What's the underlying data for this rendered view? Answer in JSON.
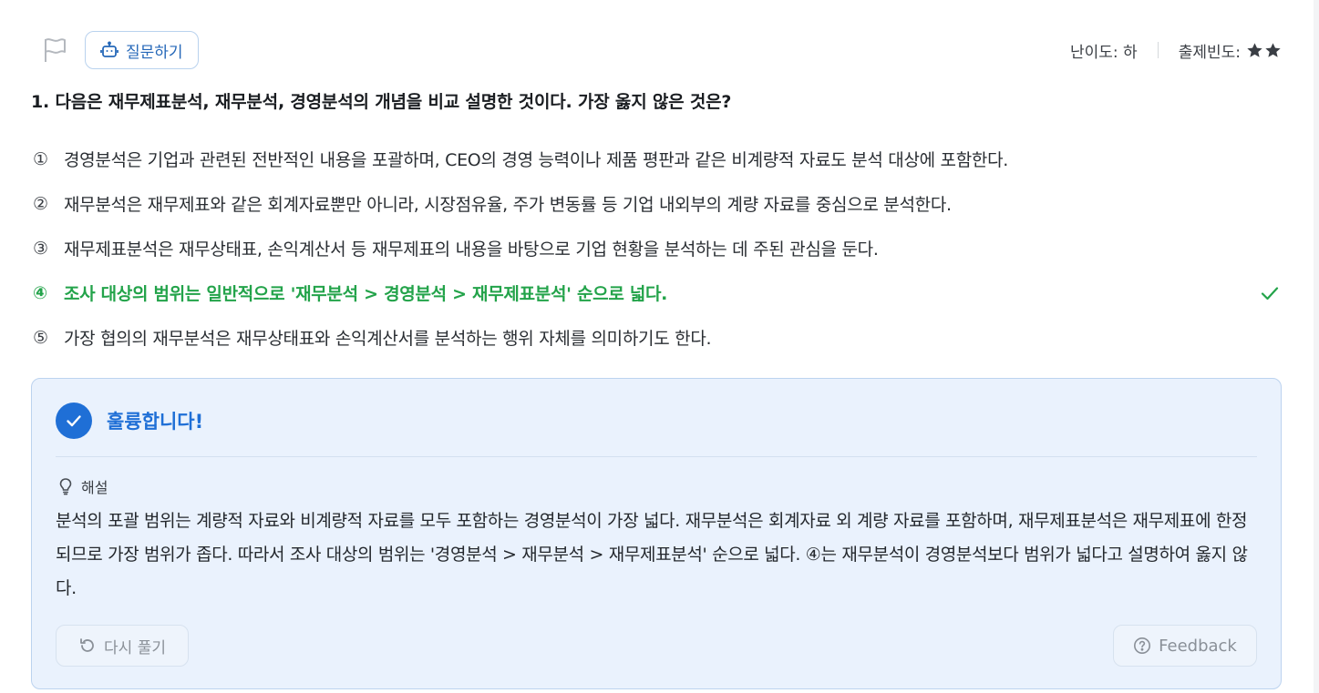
{
  "header": {
    "ask_label": "질문하기",
    "difficulty": "난이도: 하",
    "frequency_label": "출제빈도:",
    "frequency_stars": 2
  },
  "question": {
    "text": "1. 다음은 재무제표분석, 재무분석, 경영분석의 개념을 비교 설명한 것이다. 가장 옳지 않은 것은?"
  },
  "options": [
    {
      "num": "①",
      "text": "경영분석은 기업과 관련된 전반적인 내용을 포괄하며, CEO의 경영 능력이나 제품 평판과 같은 비계량적 자료도 분석 대상에 포함한다."
    },
    {
      "num": "②",
      "text": "재무분석은 재무제표와 같은 회계자료뿐만 아니라, 시장점유율, 주가 변동률 등 기업 내외부의 계량 자료를 중심으로 분석한다."
    },
    {
      "num": "③",
      "text": "재무제표분석은 재무상태표, 손익계산서 등 재무제표의 내용을 바탕으로 기업 현황을 분석하는 데 주된 관심을 둔다."
    },
    {
      "num": "④",
      "text": "조사 대상의 범위는 일반적으로 '재무분석 > 경영분석 > 재무제표분석' 순으로 넓다."
    },
    {
      "num": "⑤",
      "text": "가장 협의의 재무분석은 재무상태표와 손익계산서를 분석하는 행위 자체를 의미하기도 한다."
    }
  ],
  "result": {
    "title": "훌륭합니다!",
    "explanation_label": "해설",
    "explanation": "분석의 포괄 범위는 계량적 자료와 비계량적 자료를 모두 포함하는 경영분석이 가장 넓다. 재무분석은 회계자료 외 계량 자료를 포함하며, 재무제표분석은 재무제표에 한정되므로 가장 범위가 좁다. 따라서 조사 대상의 범위는 '경영분석 > 재무분석 > 재무제표분석' 순으로 넓다. ④는 재무분석이 경영분석보다 범위가 넓다고 설명하여 옳지 않다.",
    "retry_label": "다시 풀기",
    "feedback_label": "Feedback"
  },
  "colors": {
    "accent": "#1f6fd6",
    "correct": "#23a34a",
    "panel_bg": "#eaf2fd"
  },
  "icons": [
    "flag-icon",
    "robot-icon",
    "star-icon",
    "check-icon",
    "check-circle-icon",
    "lightbulb-icon",
    "refresh-icon",
    "question-circle-icon"
  ]
}
